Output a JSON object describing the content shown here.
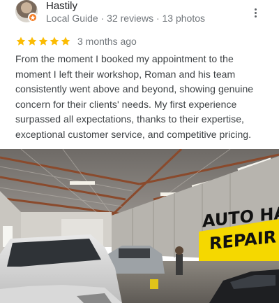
{
  "reviewer": {
    "name": "Hastily",
    "meta": "Local Guide · 32 reviews · 13 photos",
    "avatar_icon": "user-avatar",
    "badge_icon": "local-guide-star-icon",
    "badge_color": "#f47a20"
  },
  "review": {
    "rating": 5,
    "rating_max": 5,
    "star_color": "#fbbc04",
    "time": "3 months ago",
    "text": "From the moment I booked my appointment to the moment I left their workshop, Roman and his team consistently went above and beyond, showing genuine concern for their clients' needs. My first experience surpassed all expectations, thanks to their expertise, exceptional customer service, and competitive pricing."
  },
  "menu": {
    "icon": "more-vert-icon"
  },
  "photo": {
    "description_icon": "review-photo",
    "sign_text_1": "AUTO HA",
    "sign_text_2": "REPAIR",
    "sign_color": "#f5d800"
  }
}
